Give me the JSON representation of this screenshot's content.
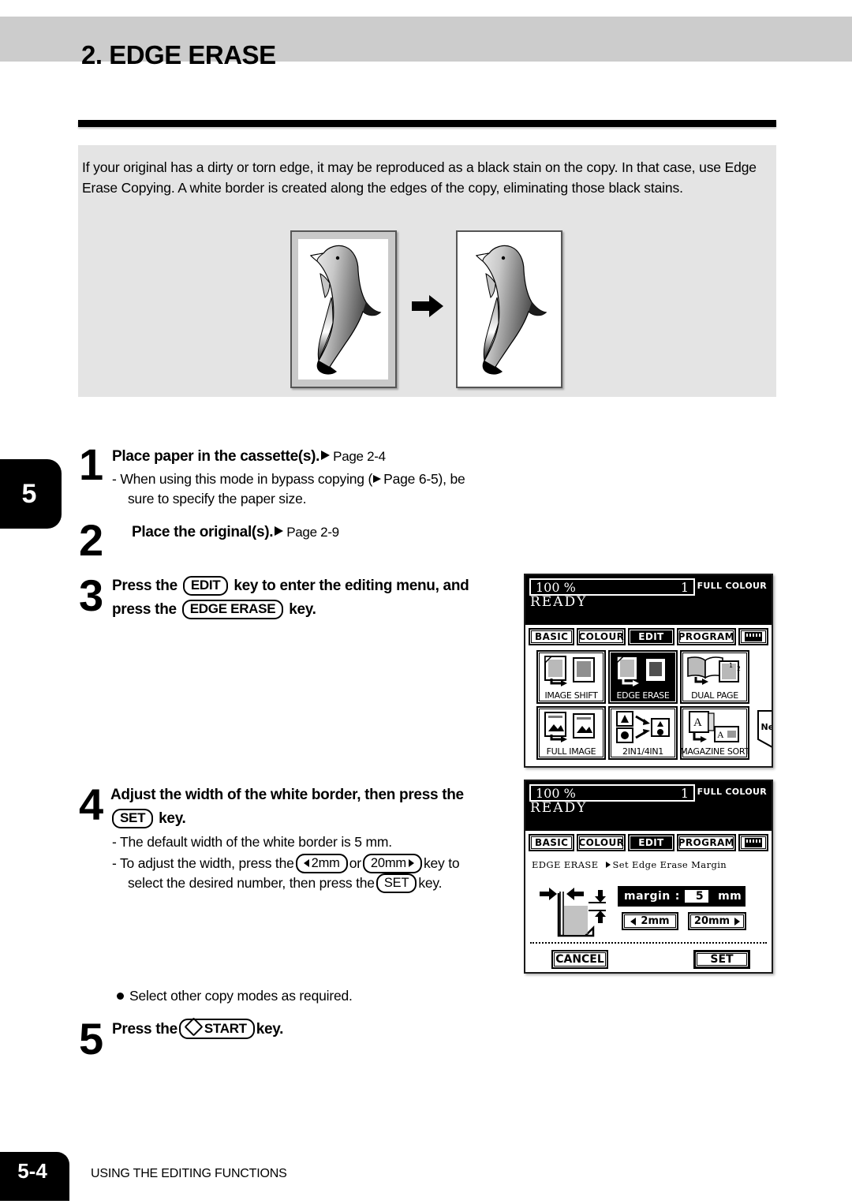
{
  "header": {
    "title": "2. EDGE ERASE"
  },
  "intro": {
    "text": "If your original has a dirty or torn edge, it may be reproduced as a black stain on the copy. In that case, use Edge Erase Copying. A white border is created along the edges of the copy, eliminating those black stains."
  },
  "figure": {
    "original_label": "original-with-dirty-edge",
    "copy_label": "copy-with-white-border",
    "arrow": "right-arrow"
  },
  "chapter_tab": {
    "number": "5"
  },
  "steps": [
    {
      "number": "1",
      "head": "Place paper in the cassette(s).",
      "ref": "Page 2-4",
      "sub_line1_pre": "-",
      "sub_line1_a": "When using this mode in bypass copying (",
      "sub_line1_ref": "Page 6-5), be",
      "sub_line2": "sure to specify the paper size."
    },
    {
      "number": "2",
      "head": "Place the original(s).",
      "ref": "Page 2-9"
    },
    {
      "number": "3",
      "head_a": "Press the",
      "key1": "EDIT",
      "head_b": "key to enter the editing menu, and",
      "head_c": "press the",
      "key2": "EDGE ERASE",
      "head_d": "key."
    },
    {
      "number": "4",
      "head_a": "Adjust the width of the white border, then press the",
      "key1": "SET",
      "head_b": "key.",
      "sub1": "The default width of the white border is 5 mm.",
      "sub2_a": "To adjust the width, press the",
      "key_2mm": "2mm",
      "sub2_b": "or",
      "key_20mm": "20mm",
      "sub2_c": "key to",
      "sub2_d": "select the desired number, then press the",
      "key_set": "SET",
      "sub2_e": "key."
    },
    {
      "number": "5",
      "note": "Select other copy modes as required.",
      "head_a": "Press the",
      "key1": "START",
      "head_b": "key."
    }
  ],
  "lcd_edit_menu": {
    "zoom": "100",
    "percent": "%",
    "copies": "1",
    "colour_mode": "FULL COLOUR",
    "status": "READY",
    "tabs": [
      {
        "label": "BASIC",
        "active": false
      },
      {
        "label": "COLOUR",
        "active": false
      },
      {
        "label": "EDIT",
        "active": true
      },
      {
        "label": "PROGRAM",
        "active": false
      }
    ],
    "keyboard_tab": "keyboard-icon",
    "functions": [
      {
        "label": "IMAGE SHIFT",
        "selected": false
      },
      {
        "label": "EDGE ERASE",
        "selected": true
      },
      {
        "label": "DUAL  PAGE",
        "selected": false
      },
      {
        "label": "FULL IMAGE",
        "selected": false
      },
      {
        "label": "2IN1/4IN1",
        "selected": false
      },
      {
        "label": "MAGAZINE SORT",
        "selected": false
      }
    ],
    "next_button": "Next"
  },
  "lcd_margin": {
    "zoom": "100",
    "percent": "%",
    "copies": "1",
    "colour_mode": "FULL COLOUR",
    "status": "READY",
    "tabs": [
      {
        "label": "BASIC",
        "active": false
      },
      {
        "label": "COLOUR",
        "active": false
      },
      {
        "label": "EDIT",
        "active": true
      },
      {
        "label": "PROGRAM",
        "active": false
      }
    ],
    "keyboard_tab": "keyboard-icon",
    "breadcrumb_mode": "EDGE ERASE",
    "breadcrumb_page": "Set Edge Erase Margin",
    "margin_label": "margin",
    "margin_colon": ":",
    "margin_value": "5",
    "margin_unit": "mm",
    "decrease_button": "2mm",
    "increase_button": "20mm",
    "cancel_button": "CANCEL",
    "set_button": "SET"
  },
  "footer": {
    "page_number": "5-4",
    "section": "USING THE EDITING FUNCTIONS"
  },
  "colors": {
    "header_band": "#cccccc",
    "intro_panel": "#e4e4e4",
    "ink": "#000000",
    "paper": "#ffffff"
  }
}
